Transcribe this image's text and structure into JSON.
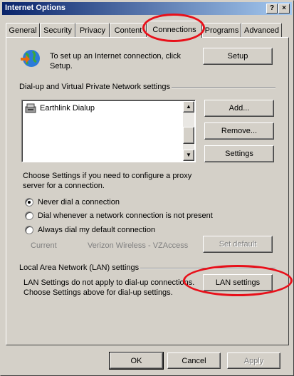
{
  "window": {
    "title": "Internet Options",
    "help_glyph": "?",
    "close_glyph": "×"
  },
  "tabs": [
    {
      "label": "General"
    },
    {
      "label": "Security"
    },
    {
      "label": "Privacy"
    },
    {
      "label": "Content"
    },
    {
      "label": "Connections"
    },
    {
      "label": "Programs"
    },
    {
      "label": "Advanced"
    }
  ],
  "setup": {
    "text_line1": "To set up an Internet connection, click",
    "text_line2": "Setup.",
    "button": "Setup"
  },
  "dialup": {
    "heading": "Dial-up and Virtual Private Network settings",
    "connections": [
      {
        "name": "Earthlink Dialup"
      }
    ],
    "add_button": "Add...",
    "remove_button": "Remove...",
    "settings_button": "Settings",
    "proxy_text_line1": "Choose Settings if you need to configure a proxy",
    "proxy_text_line2": "server for a connection.",
    "options": [
      {
        "label": "Never dial a connection",
        "selected": true
      },
      {
        "label": "Dial whenever a network connection is not present",
        "selected": false
      },
      {
        "label": "Always dial my default connection",
        "selected": false
      }
    ],
    "current_label": "Current",
    "current_value": "Verizon Wireless - VZAccess",
    "set_default_button": "Set default"
  },
  "lan": {
    "heading": "Local Area Network (LAN) settings",
    "text_line1": "LAN Settings do not apply to dial-up connections.",
    "text_line2": "Choose Settings above for dial-up settings.",
    "button": "LAN settings"
  },
  "footer": {
    "ok": "OK",
    "cancel": "Cancel",
    "apply": "Apply"
  },
  "colors": {
    "annotation": "#e8101a",
    "titlebar_start": "#0a246a",
    "face": "#d4d0c8"
  }
}
